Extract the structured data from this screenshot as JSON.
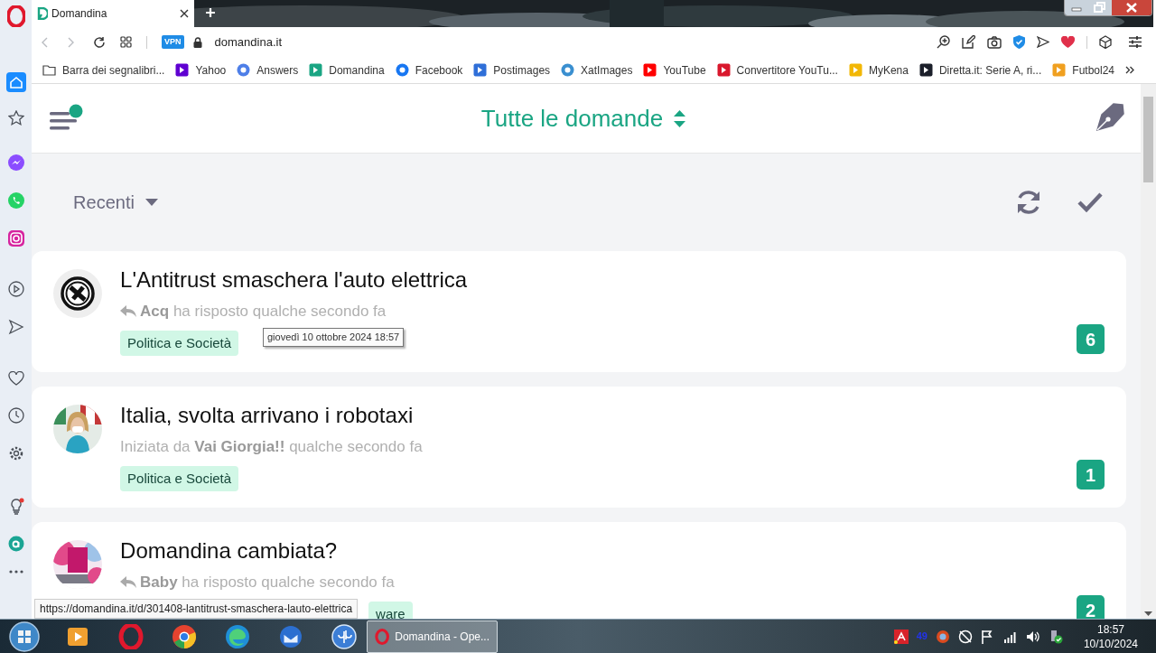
{
  "tab": {
    "title": "Domandina",
    "selected": true
  },
  "address": {
    "vpn": "VPN",
    "url": "domandina.it"
  },
  "bookmarks": [
    {
      "kind": "folder",
      "label": "Barra dei segnalibri..."
    },
    {
      "kind": "site",
      "label": "Yahoo",
      "color": "#5f01d1"
    },
    {
      "kind": "round",
      "label": "Answers",
      "color": "#4e7fe8"
    },
    {
      "kind": "site",
      "label": "Domandina",
      "color": "#1aa583"
    },
    {
      "kind": "round",
      "label": "Facebook",
      "color": "#1877f2"
    },
    {
      "kind": "site",
      "label": "Postimages",
      "color": "#2f6fd8"
    },
    {
      "kind": "round",
      "label": "XatImages",
      "color": "#3a8fd0"
    },
    {
      "kind": "site",
      "label": "YouTube",
      "color": "#ff0000"
    },
    {
      "kind": "site",
      "label": "Convertitore YouTu...",
      "color": "#d9182d"
    },
    {
      "kind": "site",
      "label": "MyKena",
      "color": "#f2b705"
    },
    {
      "kind": "site",
      "label": "Diretta.it: Serie A, ri...",
      "color": "#1b1f2a"
    },
    {
      "kind": "site",
      "label": "Futbol24",
      "color": "#f0a020"
    }
  ],
  "header": {
    "title": "Tutte le domande"
  },
  "sort": {
    "label": "Recenti"
  },
  "discussions": [
    {
      "title": "L'Antitrust smaschera l'auto elettrica",
      "avatar": {
        "kind": "emblem"
      },
      "kind": "reply",
      "meta": "**Acq** ha risposto qualche secondo fa",
      "tag": "Politica e Società",
      "count": "6"
    },
    {
      "title": "Italia, svolta arrivano i robotaxi",
      "kind": "started",
      "meta": "Iniziata da **Vai Giorgia!!** qualche secondo fa",
      "tag": "Politica e Società",
      "count": "1"
    },
    {
      "title": "Domandina cambiata?",
      "kind": "reply",
      "meta": "**Baby** ha risposto qualche secondo fa",
      "tag": "ware",
      "count": "2"
    }
  ],
  "tooltip": "giovedì 10 ottobre 2024 18:57",
  "status_url": "https://domandina.it/d/301408-lantitrust-smaschera-lauto-elettrica",
  "taskbar": {
    "window": "Domandina - Ope...",
    "tray_text": "49",
    "time": "18:57",
    "date": "10/10/2024"
  }
}
